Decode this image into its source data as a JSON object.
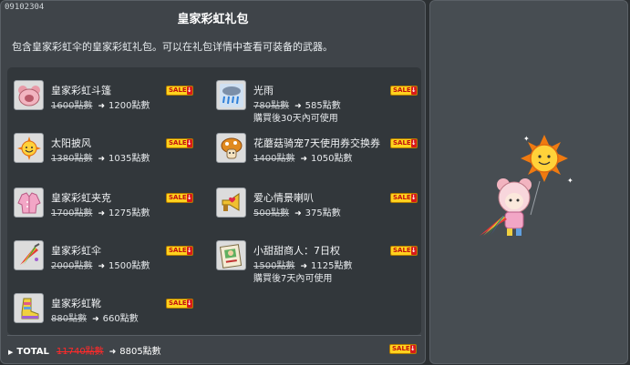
{
  "package": {
    "id": "09102304",
    "title": "皇家彩虹礼包",
    "description": "包含皇家彩虹伞的皇家彩虹礼包。可以在礼包详情中查看可装备的武器。"
  },
  "sale_badge": "SALE",
  "arrow": "➜",
  "items": [
    {
      "name": "皇家彩虹斗篷",
      "original": "1600點數",
      "price": "1200點數",
      "note": "",
      "icon": "pink-bear-cape-icon"
    },
    {
      "name": "光雨",
      "original": "780點數",
      "price": "585點數",
      "note": "購買後30天內可使用",
      "icon": "rain-cloud-icon"
    },
    {
      "name": "太阳披风",
      "original": "1380點數",
      "price": "1035點數",
      "note": "",
      "icon": "sun-cape-icon"
    },
    {
      "name": "花蘑菇骑宠7天使用券交换券",
      "original": "1400點數",
      "price": "1050點數",
      "note": "",
      "icon": "mushroom-mount-coupon-icon"
    },
    {
      "name": "皇家彩虹夹克",
      "original": "1700點數",
      "price": "1275點數",
      "note": "",
      "icon": "pink-jacket-icon"
    },
    {
      "name": "爱心情景喇叭",
      "original": "500點數",
      "price": "375點數",
      "note": "",
      "icon": "heart-megaphone-icon"
    },
    {
      "name": "皇家彩虹伞",
      "original": "2000點數",
      "price": "1500點數",
      "note": "",
      "icon": "rainbow-umbrella-icon"
    },
    {
      "name": "小甜甜商人：7日权",
      "original": "1500點數",
      "price": "1125點數",
      "note": "購買後7天內可使用",
      "icon": "merchant-permit-icon"
    },
    {
      "name": "皇家彩虹靴",
      "original": "880點數",
      "price": "660點數",
      "note": "",
      "icon": "rainbow-boots-icon"
    }
  ],
  "total": {
    "label": "TOTAL",
    "original": "11740點數",
    "price": "8805點數"
  },
  "preview": {
    "icon": "character-preview-icon"
  }
}
